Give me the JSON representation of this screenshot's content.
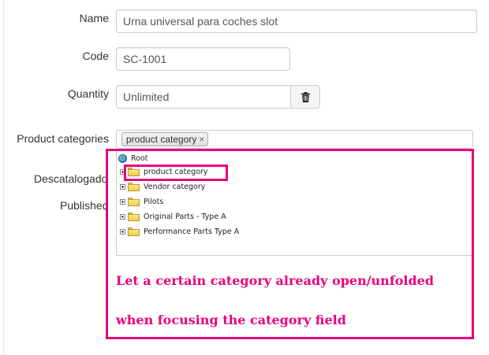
{
  "form": {
    "name_label": "Name",
    "name_value": "Urna universal para coches slot",
    "code_label": "Code",
    "code_value": "SC-1001",
    "quantity_label": "Quantity",
    "quantity_value": "Unlimited",
    "categories_label": "Product categories",
    "selected_category_chip": "product category",
    "chip_remove": "×",
    "descatalogado_label": "Descatalogado",
    "published_label": "Published"
  },
  "tree": {
    "root_label": "Root",
    "nodes": [
      {
        "label": "product category"
      },
      {
        "label": "Vendor category"
      },
      {
        "label": "Pilots"
      },
      {
        "label": "Original Parts - Type A"
      },
      {
        "label": "Performance Parts Type A"
      }
    ]
  },
  "annotation": {
    "line1": "Let a certain category already open/unfolded",
    "line2": "when focusing the category field",
    "color": "#e8007d"
  },
  "icons": {
    "trash": "trash-icon",
    "folder": "folder-icon",
    "globe": "globe-icon",
    "expand": "plus-expander-icon"
  }
}
